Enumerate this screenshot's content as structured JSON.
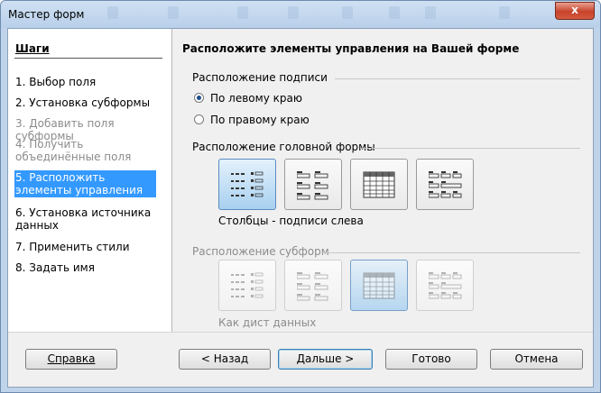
{
  "window": {
    "title": "Мастер форм",
    "close_label": "x"
  },
  "sidebar": {
    "title": "Шаги",
    "steps": [
      {
        "label": "1. Выбор поля",
        "state": "normal"
      },
      {
        "label": "2. Установка субформы",
        "state": "normal"
      },
      {
        "label": "3. Добавить поля субформы",
        "state": "disabled"
      },
      {
        "label": "4. Получить объединённые поля",
        "state": "disabled"
      },
      {
        "label": "5. Расположить элементы управления",
        "state": "selected"
      },
      {
        "label": "6. Установка источника данных",
        "state": "normal"
      },
      {
        "label": "7. Применить стили",
        "state": "normal"
      },
      {
        "label": "8. Задать имя",
        "state": "normal"
      }
    ]
  },
  "main": {
    "title": "Расположите элементы управления на Вашей форме",
    "label_placement": {
      "heading": "Расположение подписи",
      "options": [
        "По левому краю",
        "По правому краю"
      ],
      "selected": "По левому краю"
    },
    "main_form": {
      "heading": "Расположение головной формы",
      "layouts": [
        {
          "icon": "columns-labels-left-icon",
          "state": "selected"
        },
        {
          "icon": "columns-labels-top-icon",
          "state": "normal"
        },
        {
          "icon": "datasheet-icon",
          "state": "normal"
        },
        {
          "icon": "blocks-labels-top-icon",
          "state": "normal"
        }
      ],
      "caption": "Столбцы - подписи слева"
    },
    "subform": {
      "heading": "Расположение субформ",
      "layouts": [
        {
          "icon": "columns-labels-left-icon",
          "state": "disabled"
        },
        {
          "icon": "columns-labels-top-icon",
          "state": "disabled"
        },
        {
          "icon": "datasheet-icon",
          "state": "selected-disabled"
        },
        {
          "icon": "blocks-labels-top-icon",
          "state": "disabled"
        }
      ],
      "caption": "Как дист данных"
    }
  },
  "buttons": {
    "help": "Справка",
    "back": "< Назад",
    "next": "Дальше >",
    "finish": "Готово",
    "cancel": "Отмена"
  },
  "colors": {
    "selection": "#3399ff",
    "tile_selected": "#a8d0ef",
    "window_frame": "#bfd4ea"
  }
}
